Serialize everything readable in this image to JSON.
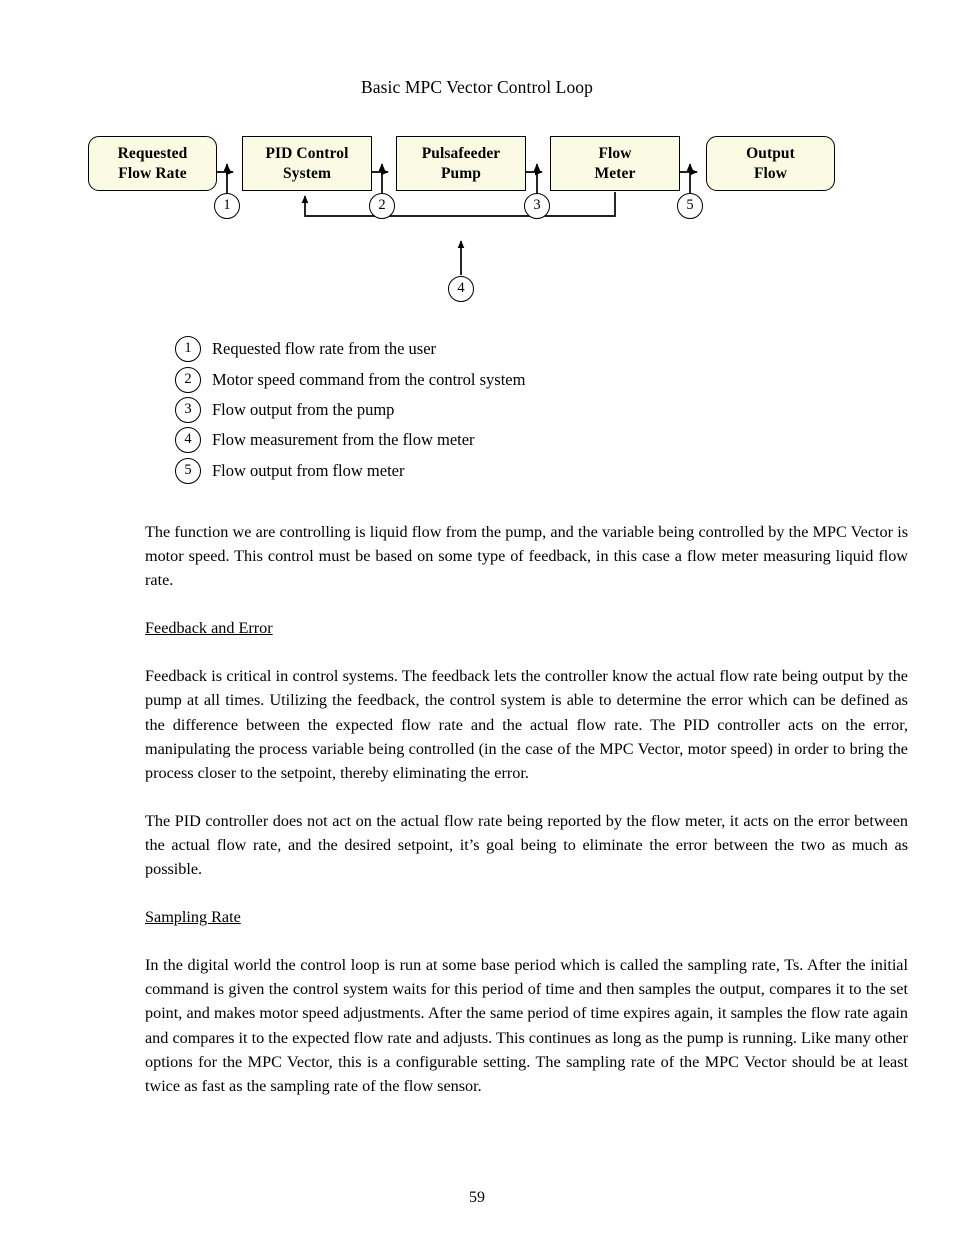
{
  "figure": {
    "title": "Basic MPC Vector Control Loop",
    "nodes": [
      {
        "id": "requested-flow-rate",
        "line1": "Requested",
        "line2": "Flow Rate",
        "shape": "rounded"
      },
      {
        "id": "pid-control-system",
        "line1": "PID Control",
        "line2": "System",
        "shape": "rect"
      },
      {
        "id": "pulsafeeder-pump",
        "line1": "Pulsafeeder",
        "line2": "Pump",
        "shape": "rect"
      },
      {
        "id": "flow-meter",
        "line1": "Flow",
        "line2": "Meter",
        "shape": "rect"
      },
      {
        "id": "output-flow",
        "line1": "Output",
        "line2": "Flow",
        "shape": "rounded"
      }
    ],
    "badges": [
      "1",
      "2",
      "3",
      "5"
    ],
    "feedback_badge": "4",
    "box_fill_color": "#FBFBE4",
    "box_border_color": "#000000"
  },
  "legend": {
    "items": [
      {
        "num": "1",
        "text": "Requested flow rate from the user"
      },
      {
        "num": "2",
        "text": "Motor speed command from the control system"
      },
      {
        "num": "3",
        "text": "Flow output from the pump"
      },
      {
        "num": "4",
        "text": "Flow measurement from the flow meter"
      },
      {
        "num": "5",
        "text": "Flow output from flow meter"
      }
    ]
  },
  "body": {
    "intro_paragraph": "The function we are controlling is liquid flow from the pump, and the variable being controlled by the MPC Vector is motor speed.  This control must be based on some type of feedback, in this case a flow meter measuring liquid flow rate.",
    "feedback_heading": "Feedback and Error",
    "feedback_paragraph": "Feedback is critical in control systems. The feedback lets the controller know the actual flow rate being output by the pump at all times. Utilizing the feedback, the control system is able to determine the error which can be defined as the difference between the expected flow rate and the actual flow rate.  The PID controller acts on the error, manipulating the process variable being controlled (in the case of the MPC Vector, motor speed) in order to bring the process closer to the setpoint, thereby eliminating the error.",
    "pid_paragraph": "The PID controller does not act on the actual flow rate being reported by the flow meter, it acts on the error between the actual flow rate, and the desired setpoint, it’s goal being to eliminate the error between the two as much as possible.",
    "sampling_heading": "Sampling Rate",
    "sampling_paragraph": "In the digital world the control loop is run at some base period which is called the sampling rate, Ts. After the initial command is given the control system waits for this period of time and then samples the output, compares it to the set point, and makes motor speed adjustments. After the same period of time expires again, it samples the flow rate again and compares it to the expected flow rate and adjusts. This continues as long as the pump is running. Like many other options for the MPC Vector, this is a configurable setting. The sampling rate of the MPC Vector should be at least twice as fast as the sampling rate of the flow sensor."
  },
  "footer": {
    "page_number": "59"
  }
}
